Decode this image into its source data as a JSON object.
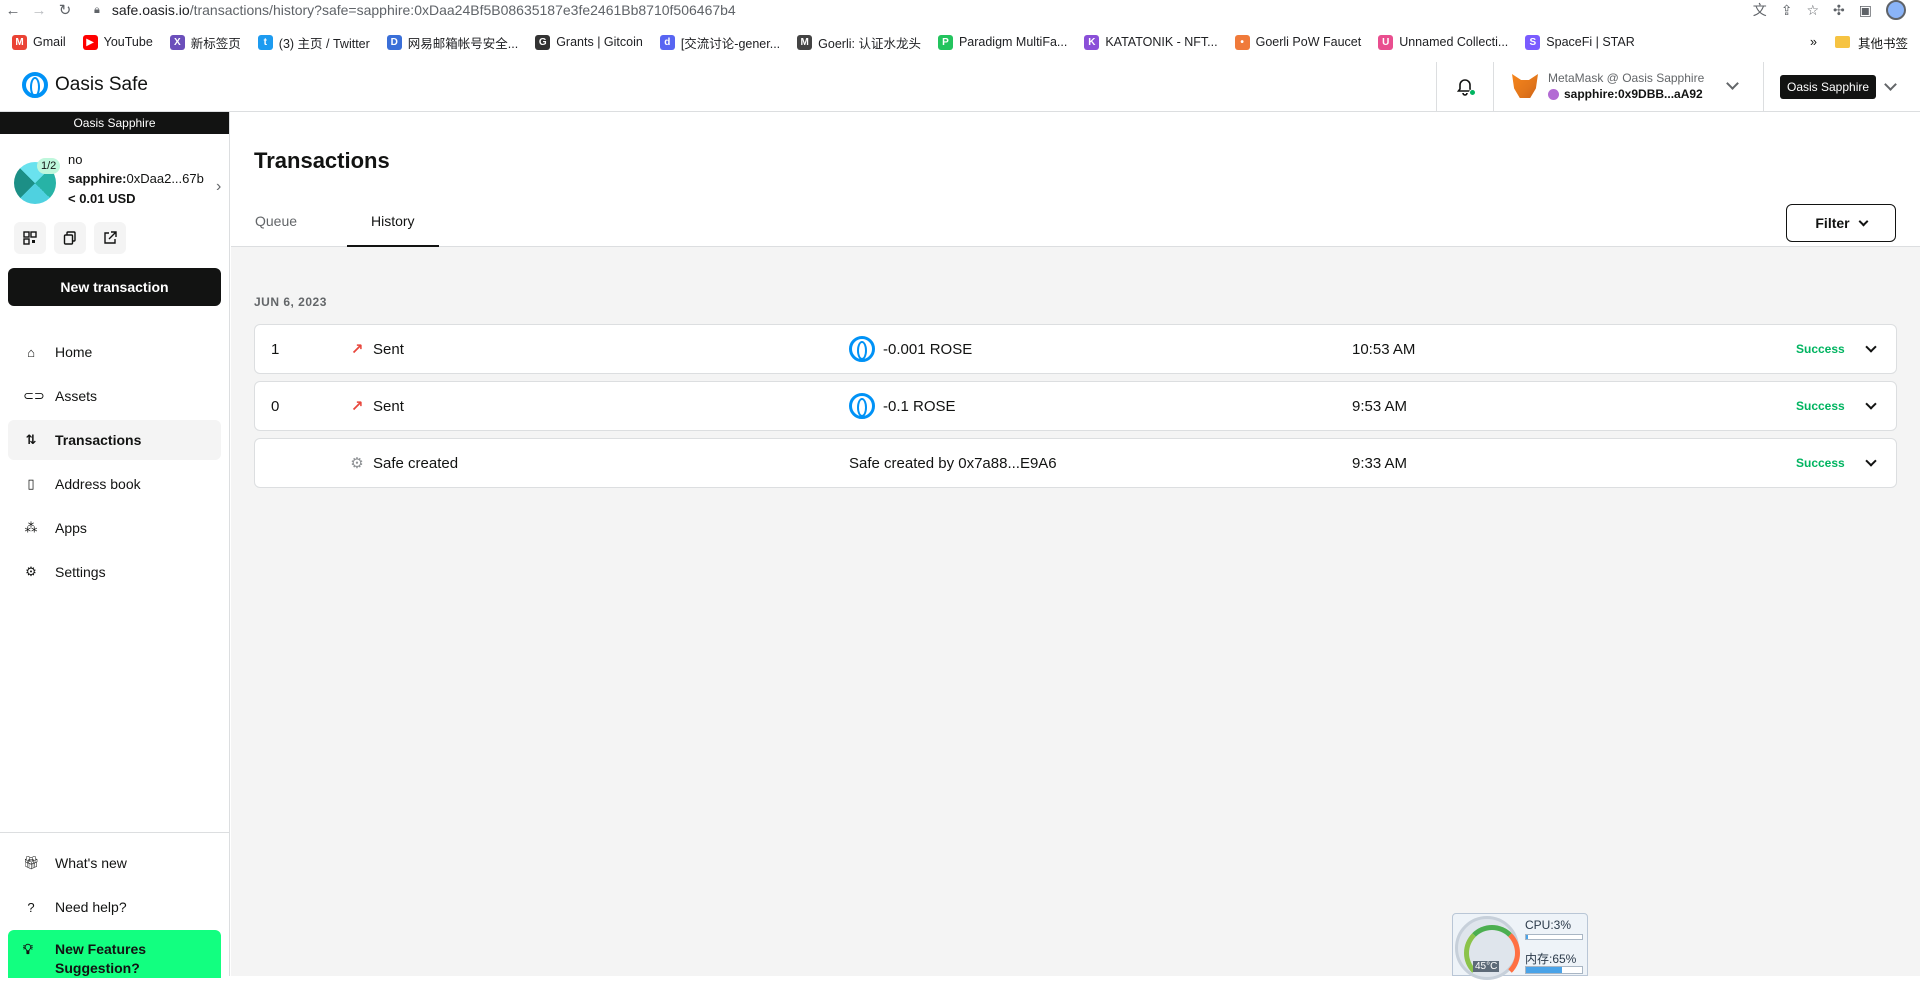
{
  "browser": {
    "url_host": "safe.oasis.io",
    "url_path": "/transactions/history?safe=sapphire:0xDaa24Bf5B08635187e3fe2461Bb8710f506467b4",
    "bookmarks": [
      {
        "label": "Gmail",
        "color": "#ea4335",
        "glyph": "M"
      },
      {
        "label": "YouTube",
        "color": "#ff0000",
        "glyph": "▶"
      },
      {
        "label": "新标签页",
        "color": "#6b4fbb",
        "glyph": "X"
      },
      {
        "label": "(3) 主页 / Twitter",
        "color": "#1d9bf0",
        "glyph": "t"
      },
      {
        "label": "网易邮箱帐号安全...",
        "color": "#3a6fd8",
        "glyph": "D"
      },
      {
        "label": "Grants | Gitcoin",
        "color": "#333333",
        "glyph": "G"
      },
      {
        "label": "[交流讨论-gener...",
        "color": "#5865f2",
        "glyph": "d"
      },
      {
        "label": "Goerli: 认证水龙头",
        "color": "#444444",
        "glyph": "M"
      },
      {
        "label": "Paradigm MultiFa...",
        "color": "#23c45e",
        "glyph": "P"
      },
      {
        "label": "KATATONIK - NFT...",
        "color": "#8a4fd8",
        "glyph": "K"
      },
      {
        "label": "Goerli PoW Faucet",
        "color": "#f07a3a",
        "glyph": "•"
      },
      {
        "label": "Unnamed Collecti...",
        "color": "#e94e8f",
        "glyph": "U"
      },
      {
        "label": "SpaceFi | STAR",
        "color": "#7a5cff",
        "glyph": "S"
      }
    ],
    "other_bookmarks": "其他书签"
  },
  "header": {
    "logo_text": "Oasis Safe",
    "wallet_provider": "MetaMask @ Oasis Sapphire",
    "wallet_address": "sapphire:0x9DBB...aA92",
    "network": "Oasis Sapphire"
  },
  "sidebar": {
    "chain": "Oasis Sapphire",
    "threshold": "1/2",
    "safe_name": "no",
    "safe_prefix": "sapphire:",
    "safe_address": "0xDaa2...67b",
    "balance": "< 0.01 USD",
    "new_transaction": "New transaction",
    "nav": [
      {
        "label": "Home",
        "icon": "⌂",
        "name": "home"
      },
      {
        "label": "Assets",
        "icon": "⊂⊃",
        "name": "assets"
      },
      {
        "label": "Transactions",
        "icon": "⇅",
        "name": "transactions",
        "active": true
      },
      {
        "label": "Address book",
        "icon": "▯",
        "name": "address-book"
      },
      {
        "label": "Apps",
        "icon": "⁂",
        "name": "apps"
      },
      {
        "label": "Settings",
        "icon": "⚙",
        "name": "settings"
      }
    ],
    "bottom": [
      {
        "label": "What's new",
        "icon": "🎁︎",
        "name": "whats-new"
      },
      {
        "label": "Need help?",
        "icon": "?",
        "name": "need-help"
      }
    ],
    "feature_line1": "New Features",
    "feature_line2": "Suggestion?"
  },
  "main": {
    "title": "Transactions",
    "tabs": {
      "queue": "Queue",
      "history": "History"
    },
    "filter": "Filter",
    "date": "JUN 6, 2023",
    "transactions": [
      {
        "nonce": "1",
        "type": "Sent",
        "kind": "sent",
        "info": "-0.001 ROSE",
        "time": "10:53 AM",
        "status": "Success"
      },
      {
        "nonce": "0",
        "type": "Sent",
        "kind": "sent",
        "info": "-0.1 ROSE",
        "time": "9:53 AM",
        "status": "Success"
      },
      {
        "nonce": "",
        "type": "Safe created",
        "kind": "created",
        "info": "Safe created by 0x7a88...E9A6",
        "time": "9:33 AM",
        "status": "Success"
      }
    ]
  },
  "system_widget": {
    "cpu": "CPU:3%",
    "cpu_percent": 3,
    "memory": "内存:65%",
    "memory_percent": 65,
    "temp": "45°C"
  }
}
